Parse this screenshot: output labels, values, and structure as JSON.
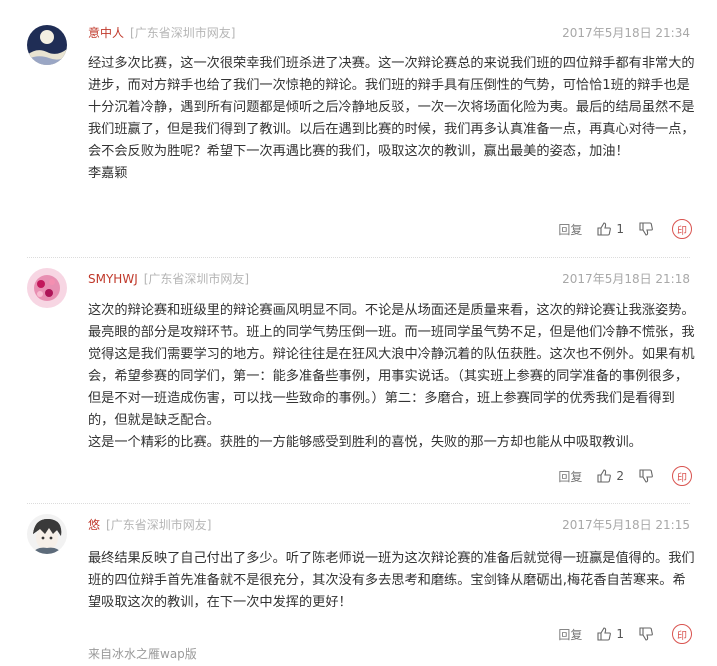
{
  "comments": [
    {
      "username": "意中人",
      "location": "[广东省深圳市网友]",
      "time": "2017年5月18日 21:34",
      "paragraphs": [
        "经过多次比赛，这一次很荣幸我们班杀进了决赛。这一次辩论赛总的来说我们班的四位辩手都有非常大的进步，而对方辩手也给了我们一次惊艳的辩论。我们班的辩手具有压倒性的气势，可恰恰1班的辩手也是十分沉着冷静，遇到所有问题都是倾听之后冷静地反驳，一次一次将场面化险为夷。最后的结局虽然不是我们班赢了，但是我们得到了教训。以后在遇到比赛的时候，我们再多认真准备一点，再真心对待一点，会不会反败为胜呢？希望下一次再遇比赛的我们，吸取这次的教训，赢出最美的姿态，加油！",
        "李嘉颖"
      ],
      "reply_label": "回复",
      "like_count": "1"
    },
    {
      "username": "SMYHWJ",
      "location": "[广东省深圳市网友]",
      "time": "2017年5月18日 21:18",
      "paragraphs": [
        "这次的辩论赛和班级里的辩论赛画风明显不同。不论是从场面还是质量来看，这次的辩论赛让我涨姿势。最亮眼的部分是攻辩环节。班上的同学气势压倒一班。而一班同学虽气势不足，但是他们冷静不慌张，我觉得这是我们需要学习的地方。辩论往往是在狂风大浪中冷静沉着的队伍获胜。这次也不例外。如果有机会，希望参赛的同学们，第一：能多准备些事例，用事实说话。（其实班上参赛的同学准备的事例很多，但是不对一班造成伤害，可以找一些致命的事例。）第二：多磨合，班上参赛同学的优秀我们是看得到的，但就是缺乏配合。",
        "这是一个精彩的比赛。获胜的一方能够感受到胜利的喜悦，失败的那一方却也能从中吸取教训。"
      ],
      "reply_label": "回复",
      "like_count": "2"
    },
    {
      "username": "悠",
      "location": "[广东省深圳市网友]",
      "time": "2017年5月18日 21:15",
      "paragraphs": [
        "最终结果反映了自己付出了多少。听了陈老师说一班为这次辩论赛的准备后就觉得一班赢是值得的。我们班的四位辩手首先准备就不是很充分，其次没有多去思考和磨练。宝剑锋从磨砺出,梅花香自苦寒来。希望吸取这次的教训，在下一次中发挥的更好！"
      ],
      "reply_label": "回复",
      "like_count": "1"
    }
  ],
  "report_glyph": "印",
  "footer": "来自冰水之雁wap版",
  "icons": [
    "thumbs-up-icon",
    "thumbs-down-icon",
    "report-icon"
  ],
  "colors": {
    "username": "#c0392b",
    "meta": "#a8a8a8",
    "report": "#d9534f"
  }
}
